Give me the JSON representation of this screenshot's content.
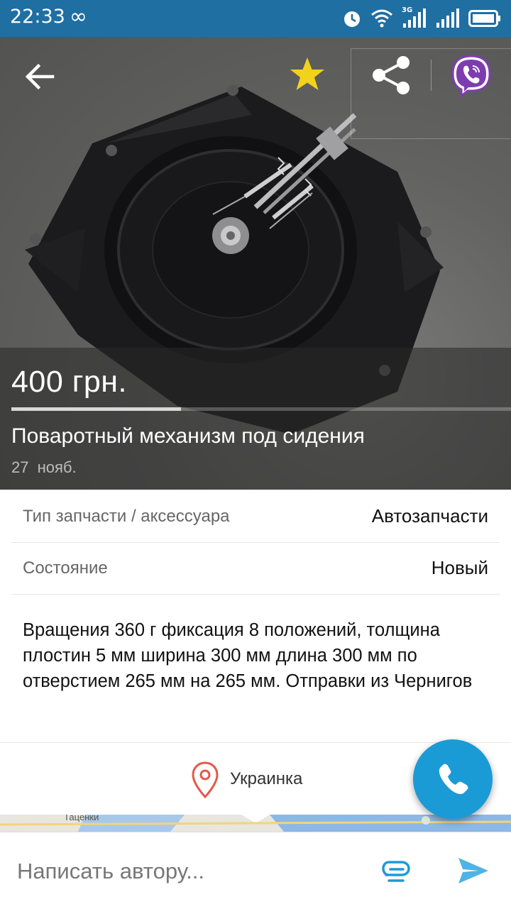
{
  "status_bar": {
    "time": "22:33",
    "network_label": "3G",
    "icons": [
      "infinity-icon",
      "alarm-icon",
      "wifi-icon",
      "signal-3g-icon",
      "signal-icon",
      "battery-icon"
    ]
  },
  "listing": {
    "price": "400 грн.",
    "title": "Поваротный механизм под сидения",
    "date": "27 нояб.",
    "photo_progress": 0.34
  },
  "attributes": [
    {
      "label": "Тип запчасти / аксессуара",
      "value": "Автозапчасти"
    },
    {
      "label": "Состояние",
      "value": "Новый"
    }
  ],
  "description": "Вращения 360 г фиксация 8 положений, толщина плостин 5 мм ширина 300 мм длина 300 мм по отверстием 265 мм на 265 мм. Отправки из Чернигов",
  "location": {
    "name": "Украинка",
    "map_label": "Таценки"
  },
  "compose": {
    "placeholder": "Написать автору..."
  },
  "colors": {
    "status_bar": "#1f6fa3",
    "accent": "#1a9bd6",
    "star": "#f2d21b",
    "viber": "#7d3daf",
    "pin": "#e5574b"
  }
}
